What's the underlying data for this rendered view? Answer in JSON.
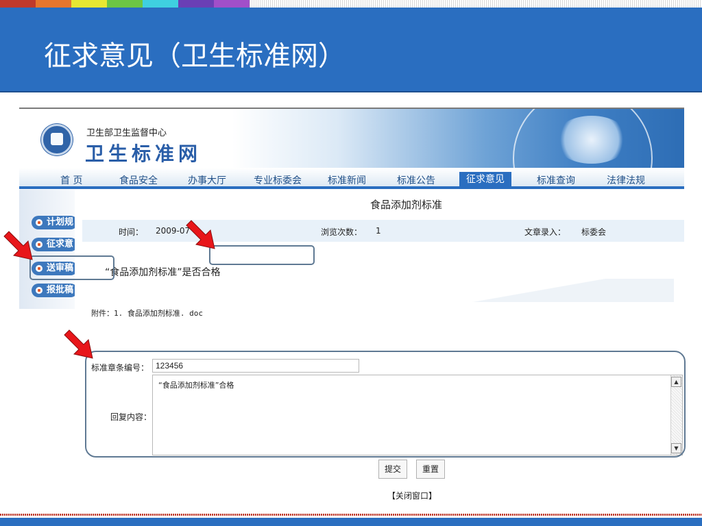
{
  "slide": {
    "title": "征求意见（卫生标准网）",
    "top_colors": [
      "#c0392b",
      "#e8762d",
      "#e8e832",
      "#6cc644",
      "#3fd0e0",
      "#6a3fb5",
      "#a14fc9"
    ]
  },
  "site": {
    "org_sub": "卫生部卫生监督中心",
    "org_main": "卫生标准网",
    "nav": [
      "首 页",
      "食品安全",
      "办事大厅",
      "专业标委会",
      "标准新闻",
      "标准公告",
      "征求意见",
      "标准查询",
      "法律法规"
    ],
    "nav_active": "征求意见",
    "left_menu": [
      "计划规",
      "征求意",
      "送审稿",
      "报批稿"
    ]
  },
  "article": {
    "title": "食品添加剂标准",
    "time_label": "时间：",
    "time_value": "2009-07",
    "views_label": "浏览次数：",
    "views_value": "1",
    "author_label": "文章录入：",
    "author_value": "标委会",
    "question": "“食品添加剂标准”是否合格",
    "attachment_label": "附件：",
    "attachment_file": "1. 食品添加剂标准. doc"
  },
  "form": {
    "clause_label": "标准章条编号：",
    "clause_value": "123456",
    "reply_label": "回复内容：",
    "reply_value": "“食品添加剂标准”合格",
    "submit": "提交",
    "reset": "重置",
    "close": "【关闭窗口】"
  },
  "annotation_color": "#e8161a"
}
